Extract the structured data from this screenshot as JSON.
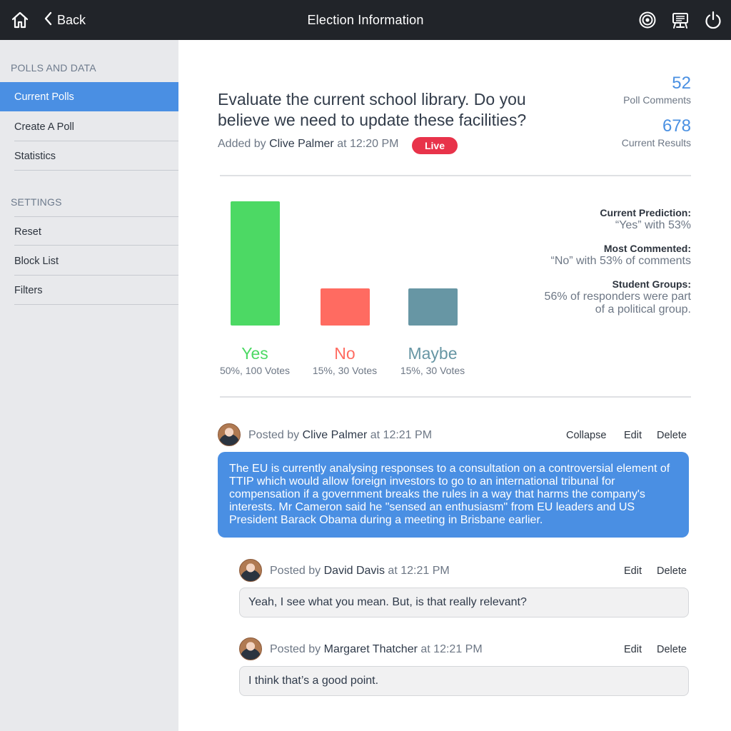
{
  "header": {
    "title": "Election Information",
    "back_label": "Back",
    "icons": [
      "home-icon",
      "chevron-left-icon",
      "target-icon",
      "presentation-board-icon",
      "power-icon"
    ]
  },
  "sidebar": {
    "sections": [
      {
        "title": "POLLS AND DATA",
        "items": [
          {
            "label": "Current Polls",
            "active": true
          },
          {
            "label": "Create A Poll",
            "active": false
          },
          {
            "label": "Statistics",
            "active": false
          }
        ]
      },
      {
        "title": "SETTINGS",
        "items": [
          {
            "label": "Reset",
            "active": false
          },
          {
            "label": "Block List",
            "active": false
          },
          {
            "label": "Filters",
            "active": false
          }
        ]
      }
    ]
  },
  "poll": {
    "question": "Evaluate the current school library. Do you believe we need to update these facilities?",
    "added_prefix": "Added by",
    "author": "Clive Palmer",
    "time": "at 12:20 PM",
    "status": "Live",
    "stats": [
      {
        "value": "52",
        "label": "Poll Comments"
      },
      {
        "value": "678",
        "label": "Current Results"
      }
    ]
  },
  "chart_data": {
    "type": "bar",
    "categories": [
      "Yes",
      "No",
      "Maybe"
    ],
    "values": [
      50,
      15,
      15
    ],
    "votes": [
      100,
      30,
      30
    ],
    "captions": [
      "50%, 100 Votes",
      "15%, 30 Votes",
      "15%, 30 Votes"
    ],
    "colors": [
      "#4cd964",
      "#ff6b61",
      "#6796a4"
    ],
    "ylim": [
      0,
      50
    ],
    "title": "",
    "xlabel": "",
    "ylabel": ""
  },
  "insights": [
    {
      "key": "Current Prediction:",
      "value": "“Yes” with 53%"
    },
    {
      "key": "Most Commented:",
      "value": "“No” with 53% of comments"
    },
    {
      "key": "Student Groups:",
      "value": "56% of responders were part of a political group."
    }
  ],
  "comments": {
    "main": {
      "prefix": "Posted by",
      "author": "Clive Palmer",
      "time": "at 12:21 PM",
      "actions": [
        "Collapse",
        "Edit",
        "Delete"
      ],
      "text": "The EU is currently analysing responses to a consultation on a controversial element of TTIP which would allow foreign investors to go to an international tribunal for compensation if a government breaks the rules in a way that harms the company's interests. Mr Cameron said he \"sensed an enthusiasm\" from EU leaders and US President Barack Obama during a meeting in Brisbane earlier."
    },
    "replies": [
      {
        "prefix": "Posted by",
        "author": "David Davis",
        "time": "at 12:21 PM",
        "actions": [
          "Edit",
          "Delete"
        ],
        "text": "Yeah, I see what you mean. But, is that really relevant?"
      },
      {
        "prefix": "Posted by",
        "author": "Margaret Thatcher",
        "time": "at 12:21 PM",
        "actions": [
          "Edit",
          "Delete"
        ],
        "text": "I think that’s a good point."
      }
    ]
  },
  "colors": {
    "topbar": "#212429",
    "accent": "#4a8fe3",
    "live": "#e8334a",
    "sidebar": "#e8e9ec"
  }
}
